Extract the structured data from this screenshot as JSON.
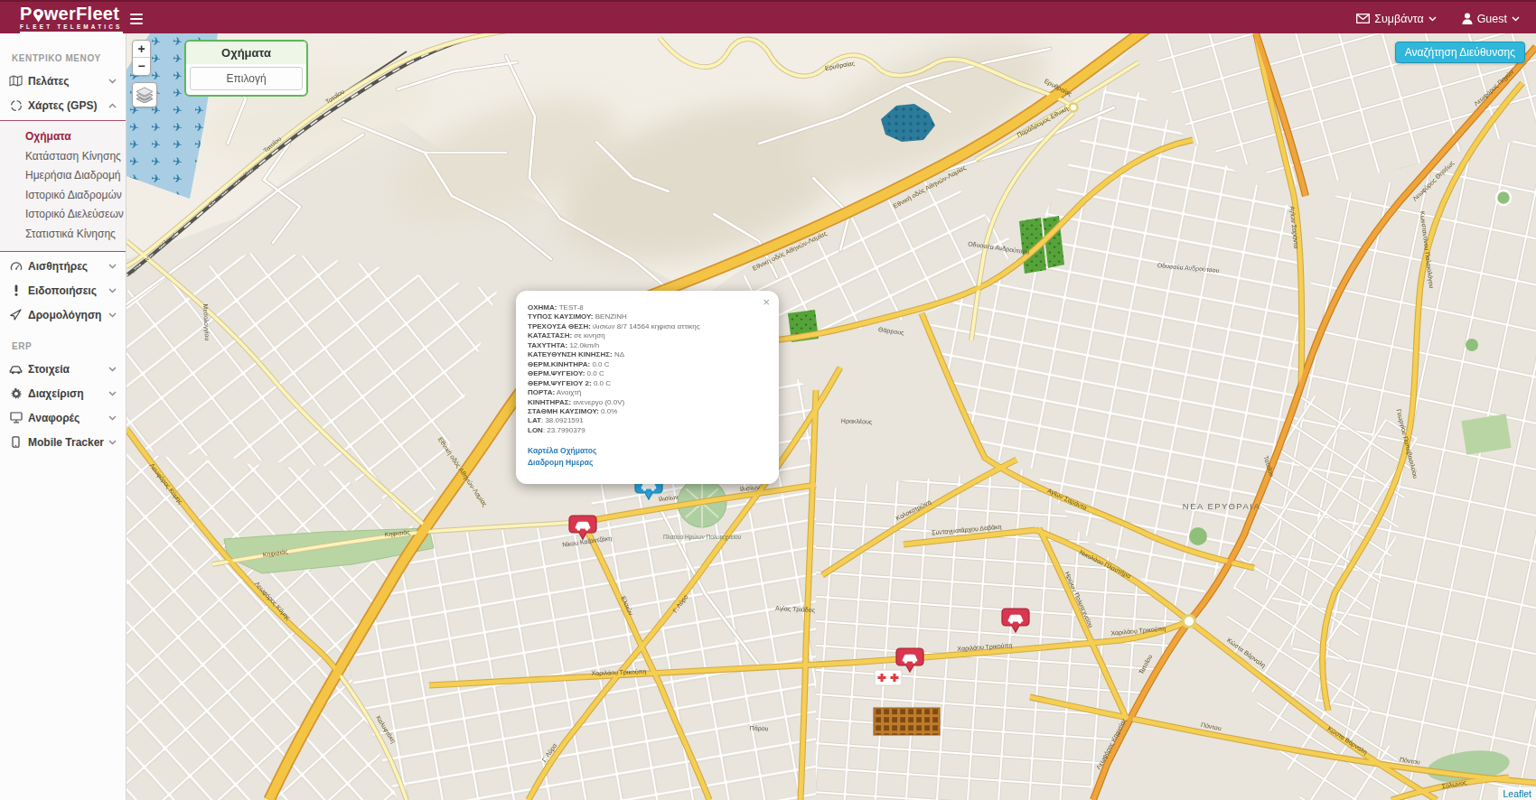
{
  "header": {
    "logo_p": "P",
    "logo_rest": "werFleet",
    "logo_subtitle": "FLEET TELEMATICS",
    "events_label": "Συμβάντα",
    "user_label": "Guest"
  },
  "sidebar": {
    "section_main": "ΚΕΝΤΡΙΚΟ ΜΕΝΟΥ",
    "section_erp": "ERP",
    "items": [
      {
        "label": "Πελάτες",
        "icon": "map-icon"
      },
      {
        "label": "Χάρτες (GPS)",
        "icon": "circle-icon",
        "expanded": true
      },
      {
        "label": "Αισθητήρες",
        "icon": "gauge-icon"
      },
      {
        "label": "Ειδοποιήσεις",
        "icon": "exclamation-icon"
      },
      {
        "label": "Δρομολόγηση",
        "icon": "navigation-icon"
      },
      {
        "label": "Στοιχεία",
        "icon": "car-icon"
      },
      {
        "label": "Διαχείριση",
        "icon": "gear-icon"
      },
      {
        "label": "Αναφορές",
        "icon": "monitor-icon"
      },
      {
        "label": "Mobile Tracker",
        "icon": "mobile-icon"
      }
    ],
    "submenu": [
      {
        "label": "Οχήματα",
        "active": true
      },
      {
        "label": "Κατάσταση Κίνησης"
      },
      {
        "label": "Ημερήσια Διαδρομή"
      },
      {
        "label": "Ιστορικό Διαδρομών"
      },
      {
        "label": "Ιστορικό Διελεύσεων"
      },
      {
        "label": "Στατιστικά Κίνησης"
      }
    ]
  },
  "map": {
    "controls": {
      "zoom_in": "+",
      "zoom_out": "−"
    },
    "panel": {
      "title": "Οχήματα",
      "button_label": "Επιλογή"
    },
    "search_button": "Αναζήτηση Διεύθυνσης",
    "attribution": "Leaflet",
    "place_label": "ΝΕΑ ΕΡΥΘΡΑΙΑ",
    "street_labels": [
      "Τατοΐου",
      "Τατοΐου",
      "Κωνσταντινουπόλεως",
      "Κωνσταντινουπόλεως",
      "Ερυθραίας",
      "Ερυθραίας",
      "Παράδρομος Εθνική",
      "Εθνική οδός Αθηνών-Λαμίας",
      "Εθνική οδός Αθηνών-Λαμίας",
      "Εθνική οδός Αθηνών-Λαμίας",
      "Λεωφόρος Κύμης",
      "Λεωφόρος Κύμης",
      "Κηφισιάς",
      "Κηφισιάς",
      "Αγίων Σαράντα",
      "Αγίων Σαράντα",
      "Αγίων Σαράντα",
      "Τατοΐου",
      "Τατοΐου",
      "Γ. Λύρα",
      "Γ. Λύρα",
      "Ελαιών",
      "Ιλισίων",
      "Ιλισίων",
      "Χαριλάου Τρικούπη",
      "Χαριλάου Τρικούπη",
      "Χαριλάου Τρικούπη",
      "Κολοκοτρώνη",
      "Συνταγματάρχου Δαβάκη",
      "Νικολάου Πλαστήρα",
      "Ηρώων Πολυτεχνείου",
      "Κώστα Βάρναλη",
      "Κώστα Βάρναλη",
      "Πόντου",
      "Πόντου",
      "Σόλωνος",
      "Λεωφόρος Θησέως",
      "Λεωφόρος Πηγών",
      "Κωνσταντίνου Παλαιολόγου",
      "Γεωργίου Παπαβασιλείου",
      "Λεωφόρος Κηφισίας",
      "Οδυσσέα Ανδρούτσου",
      "Οδυσσέα Ανδρούτσου",
      "Καλυφτάκη",
      "Πλατεία Ηρώων Πολυτεχνείου",
      "Ηρακλέους",
      "Θάρρους",
      "Πάρου",
      "Νίκου Καζαντζάκη",
      "Μεσολογγίου",
      "Αγίας Τριάδος"
    ]
  },
  "popup": {
    "close_label": "×",
    "rows": [
      {
        "label": "ΟΧΗΜΑ:",
        "value": "TEST-8"
      },
      {
        "label": "ΤΥΠΟΣ ΚΑΥΣΙΜΟΥ:",
        "value": "ΒΕΝΖΙΝΗ"
      },
      {
        "label": "ΤΡΕΧΟΥΣΑ ΘΕΣΗ:",
        "value": "ιλισιων 8/7 14564 κηφισια αττικης"
      },
      {
        "label": "ΚΑΤΑΣΤΑΣΗ:",
        "value": "σε κινηση"
      },
      {
        "label": "ΤΑΧΥΤΗΤΑ:",
        "value": "12.0km/h"
      },
      {
        "label": "ΚΑΤΕΥΘΥΝΣΗ ΚΙΝΗΣΗΣ:",
        "value": "ΝΔ"
      },
      {
        "label": "ΘΕΡΜ.ΚΙΝΗΤΗΡΑ:",
        "value": "0.0 C"
      },
      {
        "label": "ΘΕΡΜ.ΨΥΓΕΙΟΥ:",
        "value": "0.0 C"
      },
      {
        "label": "ΘΕΡΜ.ΨΥΓΕΙΟΥ 2:",
        "value": "0.0 C"
      },
      {
        "label": "ΠΟΡΤΑ:",
        "value": "Ανοιχτή"
      },
      {
        "label": "ΚΙΝΗΤΗΡΑΣ:",
        "value": "ανενεργο (0.0V)"
      },
      {
        "label": "ΣΤΑΘΜΗ ΚΑΥΣΙΜΟΥ:",
        "value": "0.0%"
      },
      {
        "label": "LAT",
        "value": ": 38.0921591"
      },
      {
        "label": "LON",
        "value": ": 23.7990379"
      }
    ],
    "links": [
      {
        "label": "Καρτέλα Οχήματος"
      },
      {
        "label": "Διαδρομη Ημερας"
      }
    ]
  },
  "colors": {
    "brand": "#8e2043",
    "active_item": "#9c1f3f",
    "search_button": "#30b7db",
    "link": "#2a7cb8",
    "panel_border": "#5cb85c"
  }
}
